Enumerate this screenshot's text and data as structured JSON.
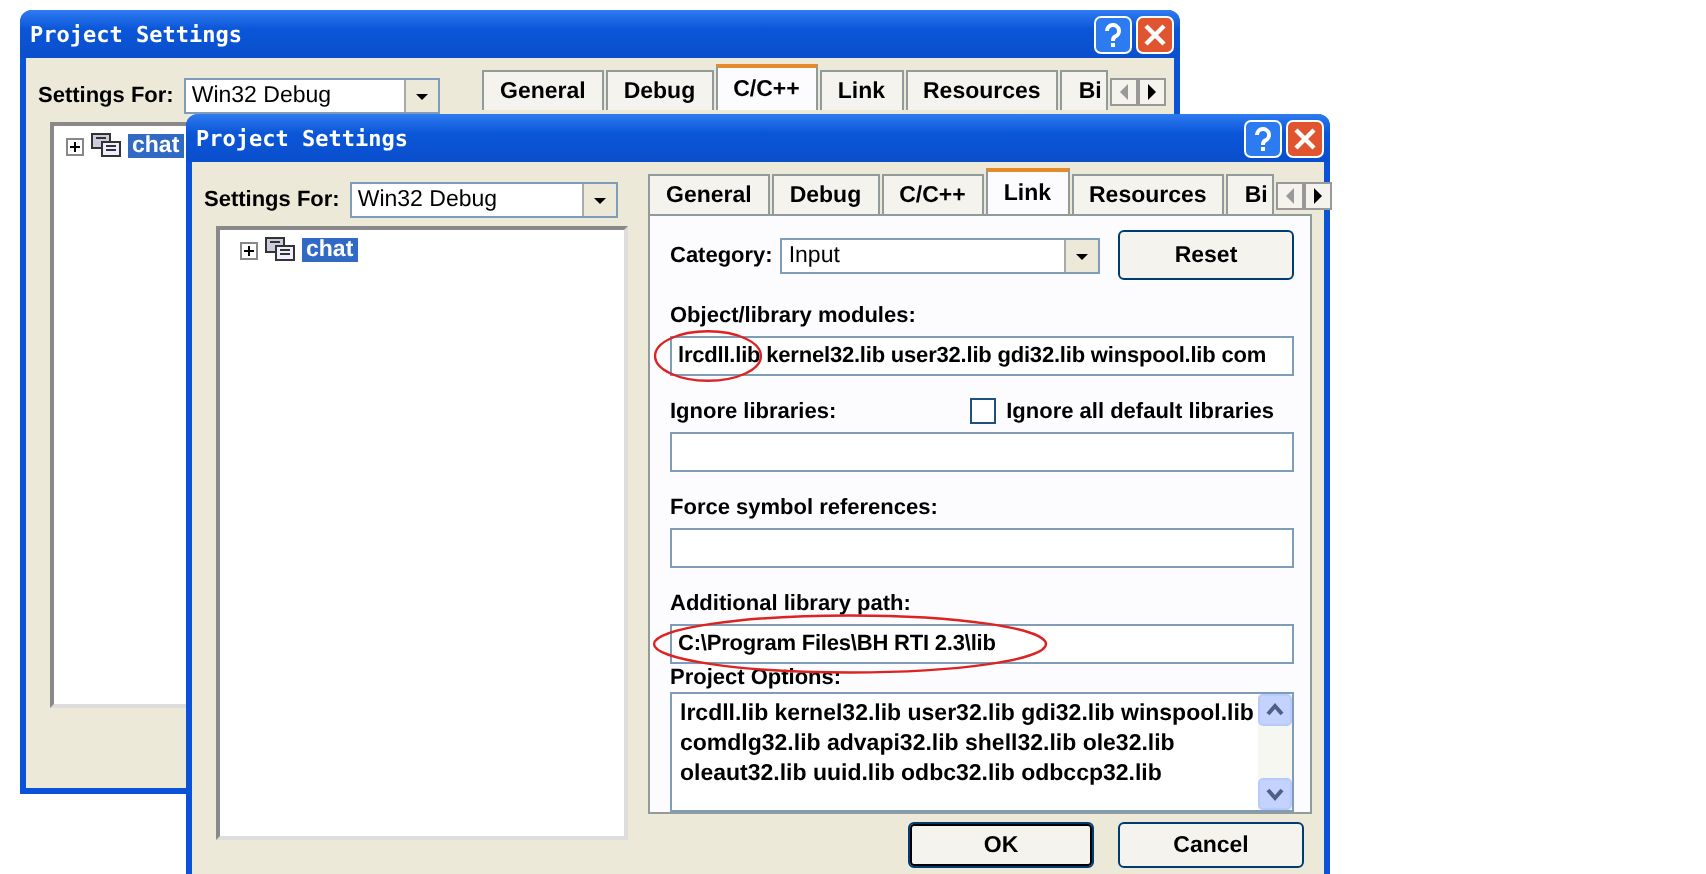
{
  "back_window": {
    "title": "Project Settings",
    "settings_for": {
      "label": "Settings For:",
      "value": "Win32 Debug"
    },
    "tabs": [
      {
        "label": "General",
        "selected": false
      },
      {
        "label": "Debug",
        "selected": false
      },
      {
        "label": "C/C++",
        "selected": true
      },
      {
        "label": "Link",
        "selected": false
      },
      {
        "label": "Resources",
        "selected": false
      },
      {
        "label": "Bi",
        "selected": false
      }
    ],
    "tree": [
      {
        "label": "chat",
        "selected": true,
        "expanded": false
      }
    ]
  },
  "front_window": {
    "title": "Project Settings",
    "settings_for": {
      "label": "Settings For:",
      "value": "Win32 Debug"
    },
    "tree": [
      {
        "label": "chat",
        "selected": true,
        "expanded": false
      }
    ],
    "tabs": [
      {
        "label": "General",
        "selected": false
      },
      {
        "label": "Debug",
        "selected": false
      },
      {
        "label": "C/C++",
        "selected": false
      },
      {
        "label": "Link",
        "selected": true
      },
      {
        "label": "Resources",
        "selected": false
      },
      {
        "label": "Bi",
        "selected": false
      }
    ],
    "category": {
      "label": "Category:",
      "value": "Input"
    },
    "reset_button": "Reset",
    "fields": [
      {
        "label": "Object/library modules:",
        "value": "lrcdll.lib kernel32.lib user32.lib gdi32.lib winspool.lib com",
        "circled": true
      },
      {
        "label": "Ignore libraries:",
        "circled": false,
        "checkbox": {
          "label": "Ignore all default libraries",
          "checked": false
        }
      },
      {
        "label": "Force symbol references:",
        "circled": false
      },
      {
        "label": "Additional library path:",
        "value": "C:\\Program Files\\BH RTI 2.3\\lib",
        "circled": true
      }
    ],
    "project_options": {
      "label": "Project Options:",
      "lines": [
        "lrcdll.lib kernel32.lib user32.lib gdi32.lib winspool.lib",
        "comdlg32.lib advapi32.lib shell32.lib ole32.lib",
        "oleaut32.lib uuid.lib odbc32.lib odbccp32.lib"
      ]
    },
    "buttons": [
      "OK",
      "Cancel"
    ]
  }
}
